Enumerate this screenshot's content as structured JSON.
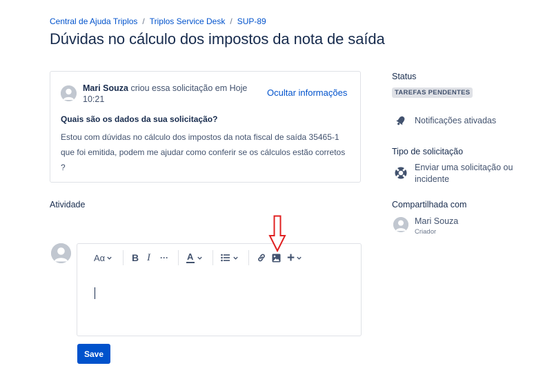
{
  "breadcrumb": {
    "items": [
      "Central de Ajuda Triplos",
      "Triplos Service Desk",
      "SUP-89"
    ],
    "separator": "/"
  },
  "page_title": "Dúvidas no cálculo dos impostos da nota de saída",
  "request": {
    "creator_name": "Mari Souza",
    "created_text": "criou essa solicitação em Hoje 10:21",
    "hide_info_label": "Ocultar informações",
    "question": "Quais são os dados da sua solicitação?",
    "description": "Estou com dúvidas no cálculo dos impostos da nota fiscal de saída 35465-1 que foi emitida, podem me ajudar como conferir se os cálculos estão corretos ?"
  },
  "activity": {
    "label": "Atividade",
    "toolbar": {
      "text_style_label": "Aα",
      "bold_label": "B",
      "italic_label": "I",
      "more_label": "···",
      "text_color_label": "A",
      "list_icon": "bullet-list-icon",
      "link_icon": "link-icon",
      "image_icon": "image-icon",
      "insert_label": "+"
    },
    "save_label": "Save"
  },
  "sidebar": {
    "status_label": "Status",
    "status_value": "TAREFAS PENDENTES",
    "notifications_label": "Notificações ativadas",
    "request_type_label": "Tipo de solicitação",
    "request_type_value": "Enviar uma solicitação ou incidente",
    "shared_with_label": "Compartilhada com",
    "shared_user_name": "Mari Souza",
    "shared_user_role": "Criador"
  },
  "colors": {
    "link": "#0052cc",
    "primary_button": "#0052cc",
    "annotation_arrow": "#e02020",
    "lozenge_bg": "#dfe1e6"
  }
}
